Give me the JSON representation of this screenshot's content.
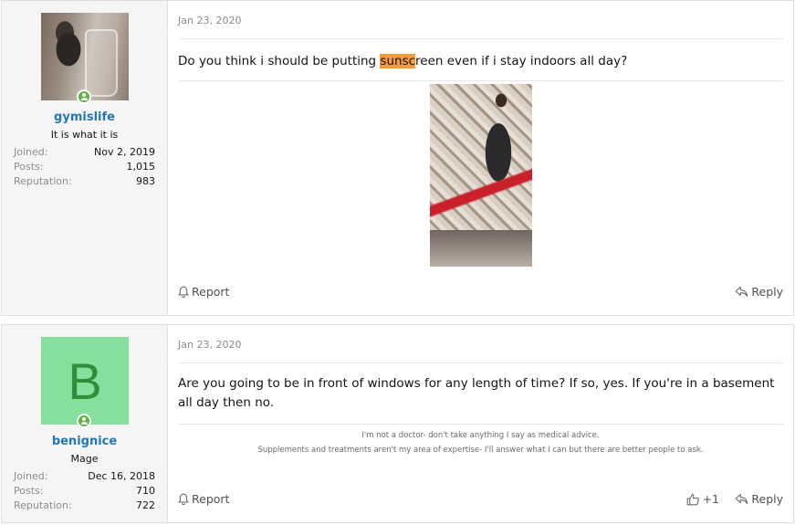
{
  "posts": [
    {
      "author": {
        "name": "gymislife",
        "title": "It is what it is",
        "joined_label": "Joined:",
        "joined": "Nov 2, 2019",
        "posts_label": "Posts:",
        "posts": "1,015",
        "rep_label": "Reputation:",
        "reputation": "983"
      },
      "date": "Jan 23, 2020",
      "content_before": "Do you think i should be putting ",
      "content_highlight": "sunsc",
      "content_after": "reen even if i stay indoors all day?",
      "report_label": "Report",
      "reply_label": "Reply"
    },
    {
      "author": {
        "avatar_letter": "B",
        "name": "benignice",
        "title": "Mage",
        "joined_label": "Joined:",
        "joined": "Dec 16, 2018",
        "posts_label": "Posts:",
        "posts": "710",
        "rep_label": "Reputation:",
        "reputation": "722"
      },
      "date": "Jan 23, 2020",
      "content": "Are you going to be in front of windows for any length of time? If so, yes. If you're in a basement all day then no.",
      "signature_line1": "I'm not a doctor- don't take anything I say as medical advice.",
      "signature_line2": "Supplements and treatments aren't my area of expertise- I'll answer what I can but there are better people to ask.",
      "report_label": "Report",
      "like_count": "+1",
      "reply_label": "Reply"
    }
  ],
  "colors": {
    "username": "#2577b1",
    "highlight": "#f79a3a",
    "online": "#63b144",
    "letter_avatar_bg": "#85e09d",
    "letter_avatar_fg": "#2e8f3a"
  },
  "icons": [
    "online-status-icon",
    "report-icon",
    "reply-icon",
    "like-icon"
  ]
}
